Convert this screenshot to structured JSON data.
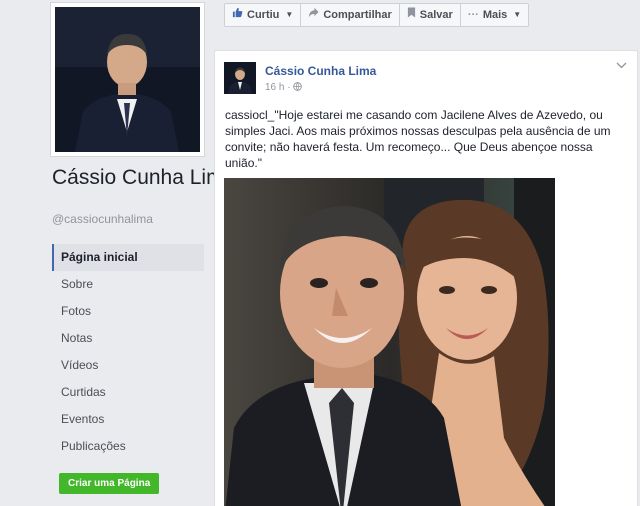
{
  "page": {
    "name": "Cássio Cunha Lima",
    "handle": "@cassiocunhalima",
    "verified": true
  },
  "sidebar": {
    "items": [
      {
        "label": "Página inicial",
        "active": true
      },
      {
        "label": "Sobre",
        "active": false
      },
      {
        "label": "Fotos",
        "active": false
      },
      {
        "label": "Notas",
        "active": false
      },
      {
        "label": "Vídeos",
        "active": false
      },
      {
        "label": "Curtidas",
        "active": false
      },
      {
        "label": "Eventos",
        "active": false
      },
      {
        "label": "Publicações",
        "active": false
      }
    ],
    "create_page_label": "Criar uma Página"
  },
  "actions": {
    "like_label": "Curtiu",
    "share_label": "Compartilhar",
    "save_label": "Salvar",
    "more_label": "Mais"
  },
  "post": {
    "author": "Cássio Cunha Lima",
    "time": "16 h",
    "text": "cassiocl_\"Hoje estarei me casando com Jacilene Alves de Azevedo, ou simples Jaci. Aos mais próximos nossas desculpas pela ausência de um convite; não haverá festa. Um recomeço... Que Deus abençoe nossa união.\""
  },
  "colors": {
    "brand_blue": "#4267b2",
    "link_blue": "#365899",
    "create_green": "#42b72a",
    "background": "#e9ebee"
  },
  "icons": {
    "like": "thumbs-up-icon",
    "share": "share-arrow-icon",
    "save": "bookmark-icon",
    "more": "ellipsis-icon",
    "verified": "verified-check-icon",
    "privacy": "globe-icon"
  }
}
